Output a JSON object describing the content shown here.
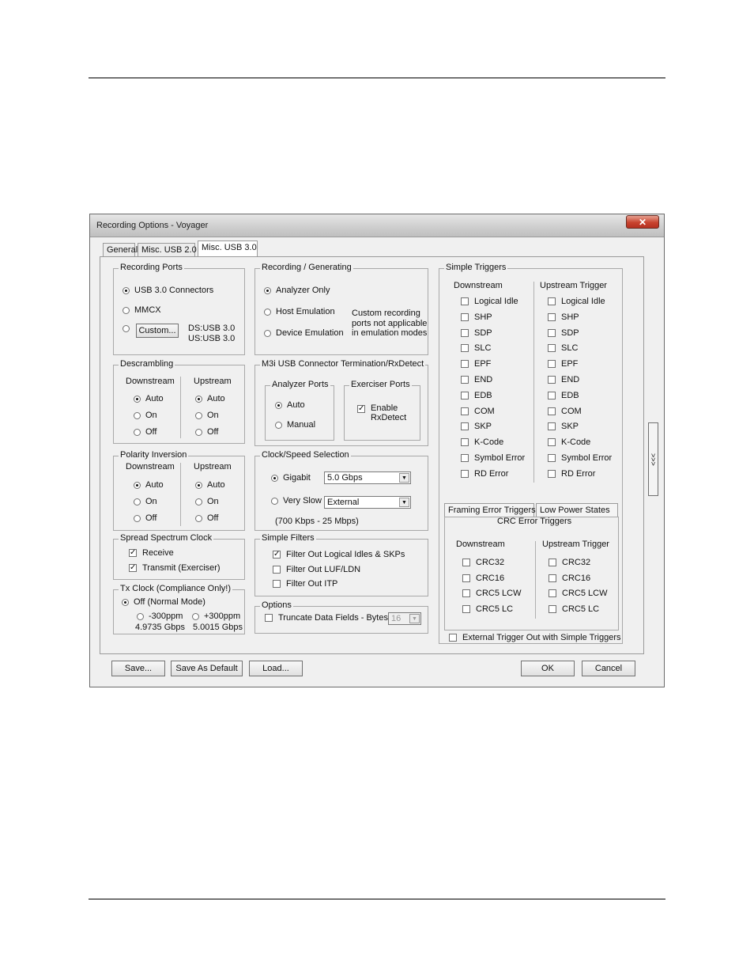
{
  "window": {
    "title": "Recording Options - Voyager",
    "close_glyph": "✕"
  },
  "tabs": [
    {
      "label": "General"
    },
    {
      "label": "Misc. USB 2.0"
    },
    {
      "label": "Misc. USB 3.0",
      "selected": true
    }
  ],
  "recording_ports": {
    "label": "Recording Ports",
    "usb3": "USB 3.0 Connectors",
    "mmcx": "MMCX",
    "custom_button": "Custom...",
    "ds": "DS:USB 3.0",
    "us": "US:USB 3.0"
  },
  "descrambling": {
    "label": "Descrambling",
    "downstream": "Downstream",
    "upstream": "Upstream",
    "auto": "Auto",
    "on": "On",
    "off": "Off"
  },
  "polarity": {
    "label": "Polarity Inversion",
    "downstream": "Downstream",
    "upstream": "Upstream",
    "auto": "Auto",
    "on": "On",
    "off": "Off"
  },
  "ssc": {
    "label": "Spread Spectrum Clock",
    "receive": "Receive",
    "transmit": "Transmit (Exerciser)"
  },
  "tx_clock": {
    "label": "Tx Clock (Compliance Only!)",
    "off": "Off  (Normal Mode)",
    "minus": "-300ppm",
    "plus": "+300ppm",
    "minus_rate": "4.9735 Gbps",
    "plus_rate": "5.0015 Gbps"
  },
  "recording_generating": {
    "label": "Recording / Generating",
    "analyzer": "Analyzer Only",
    "host": "Host Emulation",
    "device": "Device Emulation",
    "note": [
      "Custom recording",
      "ports not applicable",
      "in emulation modes"
    ]
  },
  "m3i": {
    "label": "M3i USB Connector Termination/RxDetect",
    "analyzer_ports": "Analyzer Ports",
    "auto": "Auto",
    "manual": "Manual",
    "exerciser_ports": "Exerciser Ports",
    "enable": [
      "Enable",
      "RxDetect"
    ]
  },
  "clock": {
    "label": "Clock/Speed Selection",
    "gigabit": "Gigabit",
    "gigabit_value": "5.0 Gbps",
    "very_slow": "Very Slow",
    "very_slow_value": "External",
    "range": "(700 Kbps - 25 Mbps)"
  },
  "filters": {
    "label": "Simple Filters",
    "items": [
      "Filter Out Logical Idles & SKPs",
      "Filter Out LUF/LDN",
      "Filter Out ITP"
    ]
  },
  "options": {
    "label": "Options",
    "truncate": "Truncate Data Fields - Bytes:",
    "bytes": "16"
  },
  "simple_triggers": {
    "label": "Simple Triggers",
    "downstream": "Downstream",
    "upstream": "Upstream Trigger",
    "items": [
      "Logical Idle",
      "SHP",
      "SDP",
      "SLC",
      "EPF",
      "END",
      "EDB",
      "COM",
      "SKP",
      "K-Code",
      "Symbol Error",
      "RD Error"
    ]
  },
  "error_tabs": {
    "framing": "Framing Error Triggers",
    "low_power": "Low Power States",
    "crc_title": "CRC Error Triggers",
    "downstream": "Downstream",
    "upstream": "Upstream Trigger",
    "items": [
      "CRC32",
      "CRC16",
      "CRC5 LCW",
      "CRC5 LC"
    ]
  },
  "external_trigger": "External Trigger Out with Simple Triggers",
  "expander": ">>>",
  "buttons": {
    "save": "Save...",
    "save_default": "Save As Default",
    "load": "Load...",
    "ok": "OK",
    "cancel": "Cancel"
  }
}
